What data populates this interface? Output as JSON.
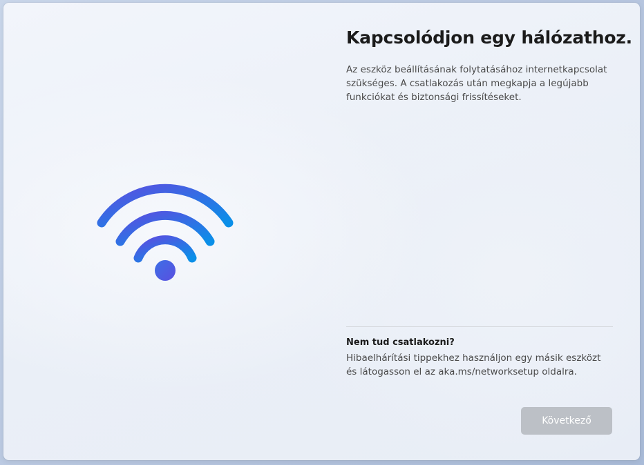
{
  "oobe": {
    "title": "Kapcsolódjon egy hálózathoz.",
    "description": "Az eszköz beállításának folytatásához internetkapcsolat szükséges. A csatlakozás után megkapja a legújabb funkciókat és biztonsági frissítéseket.",
    "help_title": "Nem tud csatlakozni?",
    "help_text": "Hibaelhárítási tippekhez használjon egy másik eszközt és látogasson el az aka.ms/networksetup oldalra.",
    "next_button_label": "Következő",
    "next_button_enabled": false
  },
  "illustration": {
    "icon": "wifi-icon",
    "gradient_start": "#5a4fe0",
    "gradient_end": "#0a8fe8"
  },
  "colors": {
    "title_text": "#1b1b1b",
    "body_text": "#4a4a4a",
    "button_disabled_bg": "#bcc0c6",
    "divider": "#d6d9de"
  }
}
